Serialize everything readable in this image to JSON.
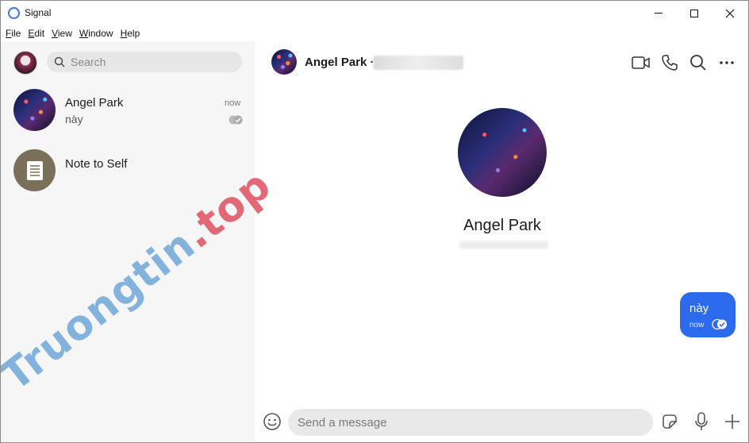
{
  "window": {
    "title": "Signal",
    "controls": {
      "minimize": "minimize",
      "maximize": "maximize",
      "close": "close"
    }
  },
  "menu": {
    "items": [
      {
        "accel": "F",
        "rest": "ile"
      },
      {
        "accel": "E",
        "rest": "dit"
      },
      {
        "accel": "V",
        "rest": "iew"
      },
      {
        "accel": "W",
        "rest": "indow"
      },
      {
        "accel": "H",
        "rest": "elp"
      }
    ]
  },
  "sidebar": {
    "search": {
      "placeholder": "Search"
    },
    "conversations": [
      {
        "name": "Angel Park",
        "preview": "này",
        "time": "now",
        "avatar": "city-lights-photo"
      },
      {
        "name": "Note to Self",
        "preview": "",
        "time": "",
        "avatar": "note-icon"
      }
    ]
  },
  "conversation": {
    "header": {
      "name": "Angel Park ·"
    },
    "hero": {
      "name": "Angel Park"
    },
    "messages": [
      {
        "direction": "outgoing",
        "text": "này",
        "time": "now",
        "status": "delivered"
      }
    ]
  },
  "composer": {
    "placeholder": "Send a message"
  },
  "icons": {
    "header": [
      "video-call-icon",
      "phone-icon",
      "search-icon",
      "more-icon"
    ],
    "composer": [
      "emoji-icon",
      "sticker-icon",
      "microphone-icon",
      "plus-icon"
    ]
  },
  "colors": {
    "accent": "#2c6bed",
    "sidebar_bg": "#f6f6f6",
    "note_avatar": "#7a6f58"
  },
  "watermark": {
    "part1": "Truongtin",
    "part2": ".top"
  }
}
